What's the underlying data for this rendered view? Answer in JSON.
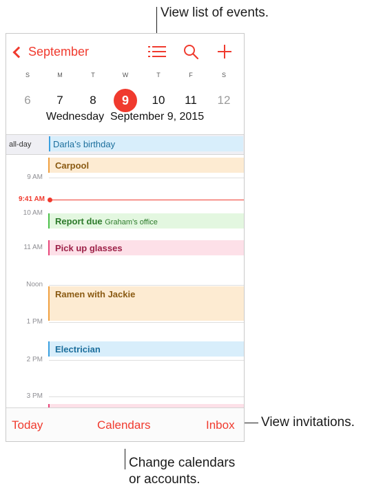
{
  "callouts": {
    "list": "View list of events.",
    "invitations": "View invitations.",
    "calendars_line1": "Change calendars",
    "calendars_line2": "or accounts."
  },
  "nav": {
    "back_label": "September",
    "icons": [
      "list-icon",
      "search-icon",
      "add-icon"
    ]
  },
  "week": {
    "days": [
      "S",
      "M",
      "T",
      "W",
      "T",
      "F",
      "S"
    ],
    "dates": [
      "6",
      "7",
      "8",
      "9",
      "10",
      "11",
      "12"
    ],
    "selected_index": 3
  },
  "date_header": {
    "weekday": "Wednesday",
    "date": "September 9, 2015"
  },
  "all_day": {
    "label": "all-day",
    "event": "Darla’s birthday"
  },
  "timeline": {
    "hours": [
      "9 AM",
      "10 AM",
      "11 AM",
      "Noon",
      "1 PM",
      "2 PM",
      "3 PM"
    ],
    "now_label": "9:41 AM"
  },
  "events": [
    {
      "title": "Carpool",
      "location": ""
    },
    {
      "title": "Report due",
      "location": "Graham’s office"
    },
    {
      "title": "Pick up glasses",
      "location": ""
    },
    {
      "title": "Ramen with Jackie",
      "location": ""
    },
    {
      "title": "Electrician",
      "location": ""
    }
  ],
  "toolbar": {
    "today": "Today",
    "calendars": "Calendars",
    "inbox": "Inbox"
  },
  "colors": {
    "accent": "#f03a2e",
    "blue_event": "#d8eefb",
    "orange_event": "#fdebd2",
    "green_event": "#e3f7e0",
    "pink_event": "#fde0e8"
  }
}
